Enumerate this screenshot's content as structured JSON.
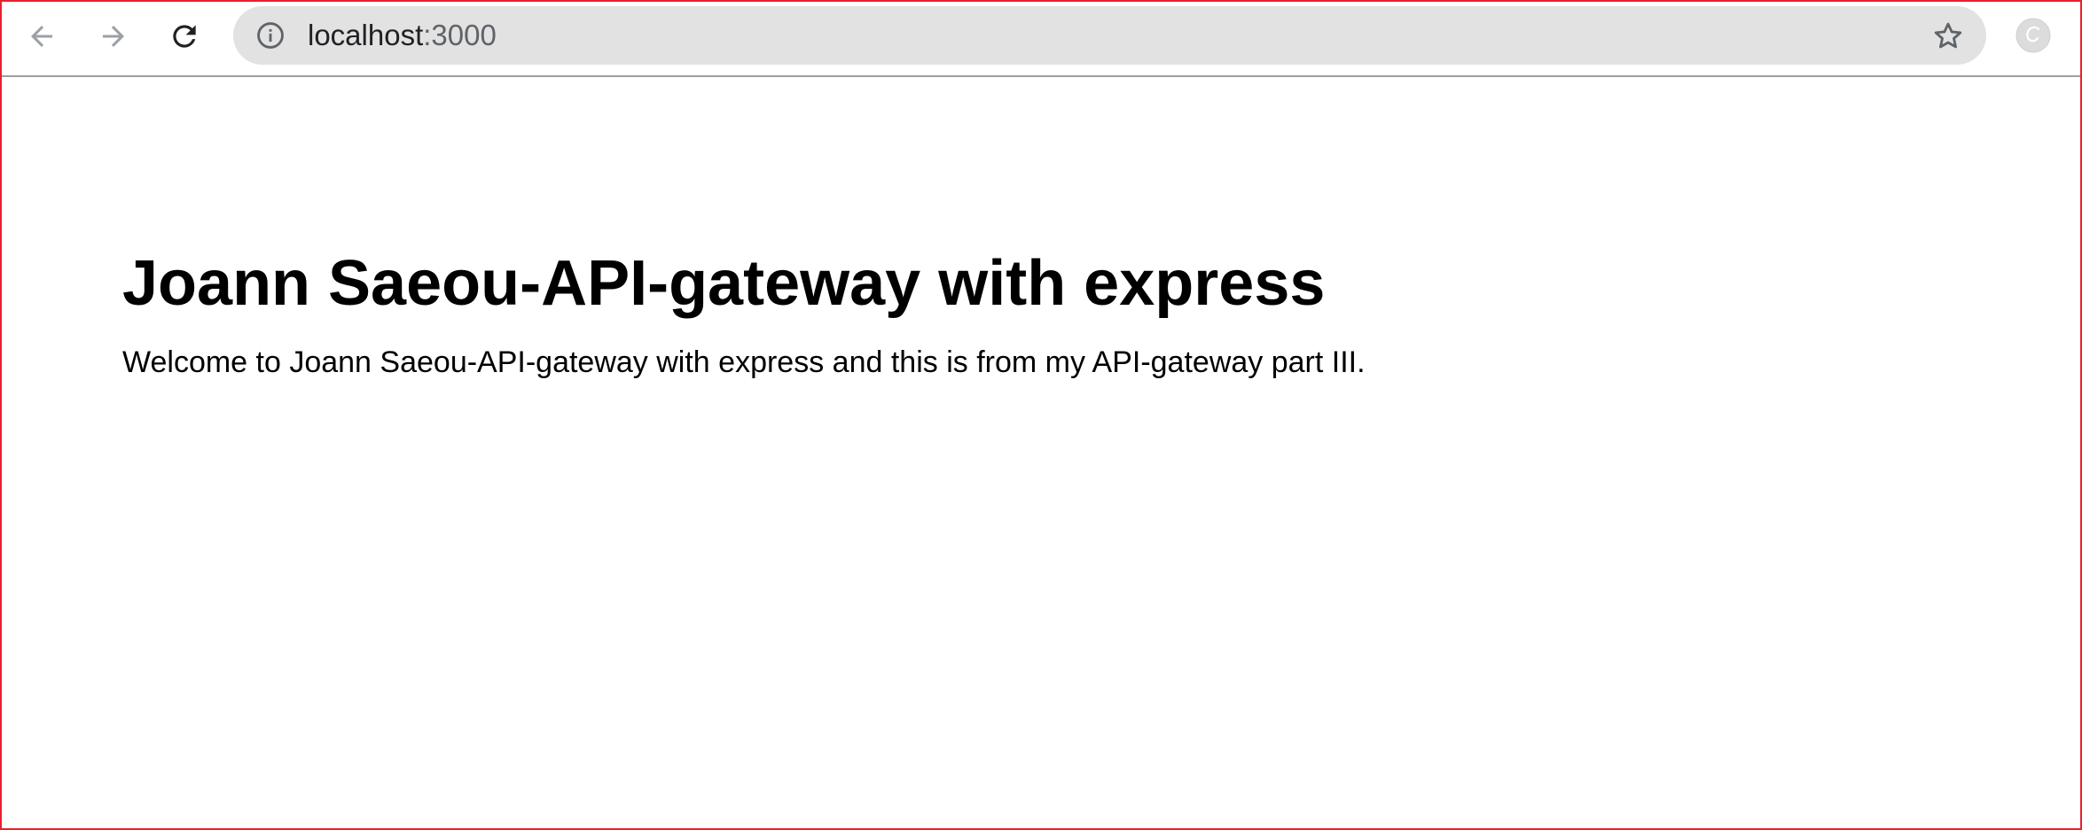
{
  "browser": {
    "address_bar": {
      "host": "localhost",
      "port": ":3000"
    },
    "icons": {
      "back": "arrow-left-icon",
      "forward": "arrow-right-icon",
      "reload": "reload-icon",
      "info": "info-icon",
      "bookmark": "star-icon",
      "extension": "extension-icon"
    },
    "colors": {
      "window_border": "#e8212b",
      "omnibox_bg": "#e2e2e2"
    }
  },
  "page": {
    "heading": "Joann Saeou-API-gateway with express",
    "paragraph": "Welcome to Joann Saeou-API-gateway with express and this is from my API-gateway part III."
  }
}
